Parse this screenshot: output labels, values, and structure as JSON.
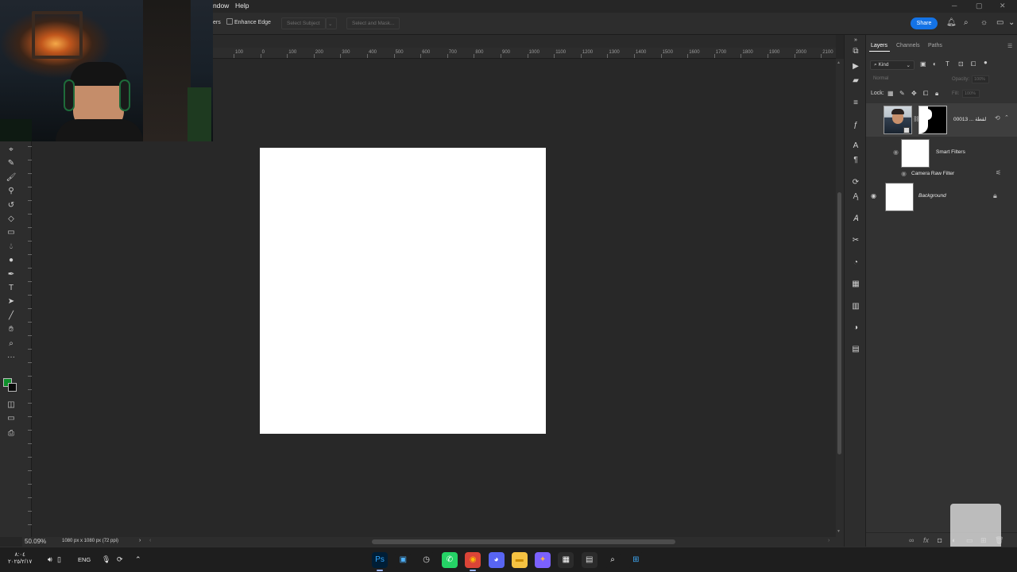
{
  "menubar": {
    "items": [
      "ndow",
      "Help"
    ],
    "window_controls": {
      "minimize": "─",
      "restore": "▢",
      "close": "✕"
    }
  },
  "options_bar": {
    "fragment_left": "ers",
    "enhance_edge_label": "Enhance Edge",
    "select_subject_label": "Select Subject",
    "select_mask_label": "Select and Mask...",
    "share_label": "Share"
  },
  "ruler": {
    "marks": [
      "100",
      "0",
      "100",
      "200",
      "300",
      "400",
      "500",
      "600",
      "700",
      "800",
      "900",
      "1000",
      "1100",
      "1200",
      "1300",
      "1400",
      "1500",
      "1600",
      "1700",
      "1800",
      "1900",
      "2000",
      "2100"
    ]
  },
  "tools": [
    "quick-selection-icon",
    "healing-brush-icon",
    "brush-icon",
    "clone-stamp-icon",
    "history-brush-icon",
    "eraser-icon",
    "gradient-icon",
    "blur-icon",
    "dodge-icon",
    "pen-icon",
    "type-icon",
    "path-selection-icon",
    "line-icon",
    "hand-icon",
    "zoom-icon",
    "more-tools-icon"
  ],
  "colors": {
    "foreground": "#0e8f2a",
    "background": "#0a0a0a",
    "accent": "#1473e6",
    "canvas": "#ffffff"
  },
  "status": {
    "zoom": "50.09%",
    "doc_info": "1080 px x 1080 px (72 ppi)",
    "arrow": "›"
  },
  "layers_panel": {
    "tabs": [
      "Layers",
      "Channels",
      "Paths"
    ],
    "kind_label": "Kind",
    "blend_mode": "Normal",
    "opacity_label": "Opacity:",
    "opacity_value": "100%",
    "fill_label": "Fill:",
    "fill_value": "100%",
    "lock_label": "Lock:",
    "layers": [
      {
        "name": "لقطة ... 00013",
        "type": "smart-object-with-mask"
      },
      {
        "name": "Smart Filters",
        "type": "smart-filters"
      },
      {
        "name": "Camera Raw Filter",
        "type": "filter"
      },
      {
        "name": "Background",
        "type": "background",
        "locked": true
      }
    ],
    "footer_icons": [
      "link-icon",
      "fx-icon",
      "mask-icon",
      "adjustment-icon",
      "group-icon",
      "new-layer-icon",
      "trash-icon"
    ]
  },
  "taskbar": {
    "time": "٨:٠٤",
    "date": "٢٠٢٥/٢/١٧",
    "language": "ENG",
    "apps": [
      {
        "name": "Photoshop",
        "label": "Ps",
        "color": "#001e36",
        "text_color": "#31a8ff"
      },
      {
        "name": "Window",
        "label": "▣",
        "color": "#1e1e1e",
        "text_color": "#4fb3ff"
      },
      {
        "name": "Clock",
        "label": "◷",
        "color": "#1e1e1e",
        "text_color": "#dddddd"
      },
      {
        "name": "WhatsApp",
        "label": "✆",
        "color": "#25d366",
        "text_color": "#ffffff"
      },
      {
        "name": "Chrome",
        "label": "◉",
        "color": "#db4437",
        "text_color": "#fbbc05"
      },
      {
        "name": "Discord",
        "label": "◕",
        "color": "#5865f2",
        "text_color": "#ffffff"
      },
      {
        "name": "Explorer",
        "label": "▬",
        "color": "#f5c242",
        "text_color": "#c98a00"
      },
      {
        "name": "Copilot",
        "label": "✦",
        "color": "#7b61ff",
        "text_color": "#ffb347"
      },
      {
        "name": "Store",
        "label": "▦",
        "color": "#2b2b2b",
        "text_color": "#ffffff"
      },
      {
        "name": "Terminal",
        "label": "▤",
        "color": "#2b2b2b",
        "text_color": "#dddddd"
      },
      {
        "name": "Search",
        "label": "⌕",
        "color": "#1e1e1e",
        "text_color": "#ffffff"
      },
      {
        "name": "Start",
        "label": "⊞",
        "color": "#1e1e1e",
        "text_color": "#3fa9f5"
      }
    ]
  }
}
